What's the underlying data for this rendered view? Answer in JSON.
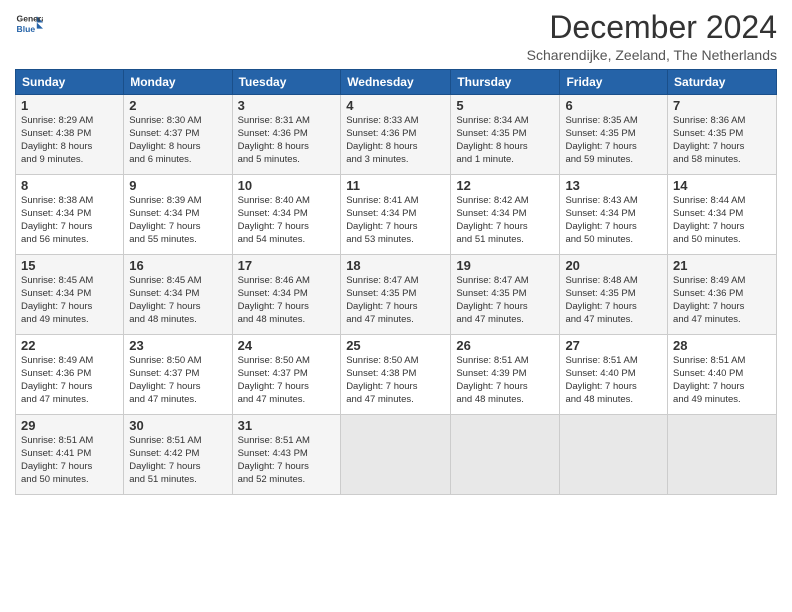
{
  "logo": {
    "line1": "General",
    "line2": "Blue"
  },
  "title": "December 2024",
  "location": "Scharendijke, Zeeland, The Netherlands",
  "headers": [
    "Sunday",
    "Monday",
    "Tuesday",
    "Wednesday",
    "Thursday",
    "Friday",
    "Saturday"
  ],
  "weeks": [
    [
      {
        "day": "1",
        "detail": "Sunrise: 8:29 AM\nSunset: 4:38 PM\nDaylight: 8 hours\nand 9 minutes."
      },
      {
        "day": "2",
        "detail": "Sunrise: 8:30 AM\nSunset: 4:37 PM\nDaylight: 8 hours\nand 6 minutes."
      },
      {
        "day": "3",
        "detail": "Sunrise: 8:31 AM\nSunset: 4:36 PM\nDaylight: 8 hours\nand 5 minutes."
      },
      {
        "day": "4",
        "detail": "Sunrise: 8:33 AM\nSunset: 4:36 PM\nDaylight: 8 hours\nand 3 minutes."
      },
      {
        "day": "5",
        "detail": "Sunrise: 8:34 AM\nSunset: 4:35 PM\nDaylight: 8 hours\nand 1 minute."
      },
      {
        "day": "6",
        "detail": "Sunrise: 8:35 AM\nSunset: 4:35 PM\nDaylight: 7 hours\nand 59 minutes."
      },
      {
        "day": "7",
        "detail": "Sunrise: 8:36 AM\nSunset: 4:35 PM\nDaylight: 7 hours\nand 58 minutes."
      }
    ],
    [
      {
        "day": "8",
        "detail": "Sunrise: 8:38 AM\nSunset: 4:34 PM\nDaylight: 7 hours\nand 56 minutes."
      },
      {
        "day": "9",
        "detail": "Sunrise: 8:39 AM\nSunset: 4:34 PM\nDaylight: 7 hours\nand 55 minutes."
      },
      {
        "day": "10",
        "detail": "Sunrise: 8:40 AM\nSunset: 4:34 PM\nDaylight: 7 hours\nand 54 minutes."
      },
      {
        "day": "11",
        "detail": "Sunrise: 8:41 AM\nSunset: 4:34 PM\nDaylight: 7 hours\nand 53 minutes."
      },
      {
        "day": "12",
        "detail": "Sunrise: 8:42 AM\nSunset: 4:34 PM\nDaylight: 7 hours\nand 51 minutes."
      },
      {
        "day": "13",
        "detail": "Sunrise: 8:43 AM\nSunset: 4:34 PM\nDaylight: 7 hours\nand 50 minutes."
      },
      {
        "day": "14",
        "detail": "Sunrise: 8:44 AM\nSunset: 4:34 PM\nDaylight: 7 hours\nand 50 minutes."
      }
    ],
    [
      {
        "day": "15",
        "detail": "Sunrise: 8:45 AM\nSunset: 4:34 PM\nDaylight: 7 hours\nand 49 minutes."
      },
      {
        "day": "16",
        "detail": "Sunrise: 8:45 AM\nSunset: 4:34 PM\nDaylight: 7 hours\nand 48 minutes."
      },
      {
        "day": "17",
        "detail": "Sunrise: 8:46 AM\nSunset: 4:34 PM\nDaylight: 7 hours\nand 48 minutes."
      },
      {
        "day": "18",
        "detail": "Sunrise: 8:47 AM\nSunset: 4:35 PM\nDaylight: 7 hours\nand 47 minutes."
      },
      {
        "day": "19",
        "detail": "Sunrise: 8:47 AM\nSunset: 4:35 PM\nDaylight: 7 hours\nand 47 minutes."
      },
      {
        "day": "20",
        "detail": "Sunrise: 8:48 AM\nSunset: 4:35 PM\nDaylight: 7 hours\nand 47 minutes."
      },
      {
        "day": "21",
        "detail": "Sunrise: 8:49 AM\nSunset: 4:36 PM\nDaylight: 7 hours\nand 47 minutes."
      }
    ],
    [
      {
        "day": "22",
        "detail": "Sunrise: 8:49 AM\nSunset: 4:36 PM\nDaylight: 7 hours\nand 47 minutes."
      },
      {
        "day": "23",
        "detail": "Sunrise: 8:50 AM\nSunset: 4:37 PM\nDaylight: 7 hours\nand 47 minutes."
      },
      {
        "day": "24",
        "detail": "Sunrise: 8:50 AM\nSunset: 4:37 PM\nDaylight: 7 hours\nand 47 minutes."
      },
      {
        "day": "25",
        "detail": "Sunrise: 8:50 AM\nSunset: 4:38 PM\nDaylight: 7 hours\nand 47 minutes."
      },
      {
        "day": "26",
        "detail": "Sunrise: 8:51 AM\nSunset: 4:39 PM\nDaylight: 7 hours\nand 48 minutes."
      },
      {
        "day": "27",
        "detail": "Sunrise: 8:51 AM\nSunset: 4:40 PM\nDaylight: 7 hours\nand 48 minutes."
      },
      {
        "day": "28",
        "detail": "Sunrise: 8:51 AM\nSunset: 4:40 PM\nDaylight: 7 hours\nand 49 minutes."
      }
    ],
    [
      {
        "day": "29",
        "detail": "Sunrise: 8:51 AM\nSunset: 4:41 PM\nDaylight: 7 hours\nand 50 minutes."
      },
      {
        "day": "30",
        "detail": "Sunrise: 8:51 AM\nSunset: 4:42 PM\nDaylight: 7 hours\nand 51 minutes."
      },
      {
        "day": "31",
        "detail": "Sunrise: 8:51 AM\nSunset: 4:43 PM\nDaylight: 7 hours\nand 52 minutes."
      },
      {
        "day": "",
        "detail": ""
      },
      {
        "day": "",
        "detail": ""
      },
      {
        "day": "",
        "detail": ""
      },
      {
        "day": "",
        "detail": ""
      }
    ]
  ]
}
